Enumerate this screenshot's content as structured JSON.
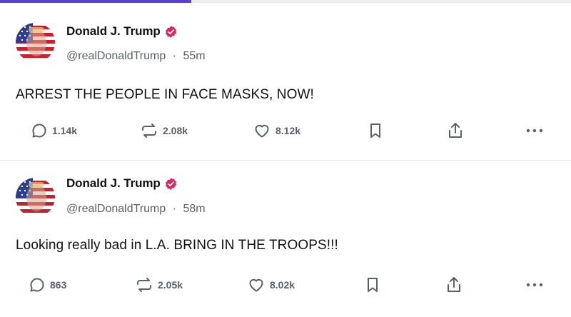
{
  "posts": [
    {
      "display_name": "Donald J. Trump",
      "handle": "@realDonaldTrump",
      "separator": "·",
      "time": "55m",
      "text": "ARREST THE PEOPLE IN FACE MASKS, NOW!",
      "replies": "1.14k",
      "reposts": "2.08k",
      "likes": "8.12k"
    },
    {
      "display_name": "Donald J. Trump",
      "handle": "@realDonaldTrump",
      "separator": "·",
      "time": "58m",
      "text": "Looking really bad in L.A. BRING IN THE TROOPS!!!",
      "replies": "863",
      "reposts": "2.05k",
      "likes": "8.02k"
    }
  ],
  "icons": {
    "reply": "comment-bubble-icon",
    "repost": "repost-arrows-icon",
    "like": "heart-icon",
    "bookmark": "bookmark-icon",
    "share": "share-upload-icon",
    "more": "more-dots-icon",
    "verified": "verified-badge-icon"
  },
  "colors": {
    "accent": "#5b3fd1",
    "verified": "#e0245e",
    "muted_text": "#59606a"
  }
}
